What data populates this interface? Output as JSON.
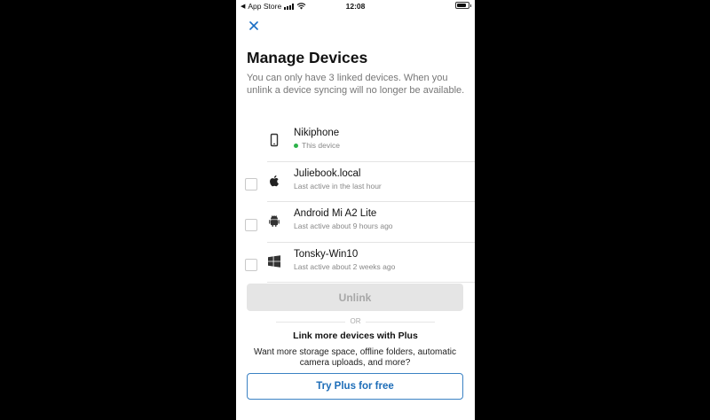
{
  "status_bar": {
    "back_app": "App Store",
    "time": "12:08",
    "battery_level": 0.85
  },
  "header": {
    "close_icon": "close-icon",
    "title": "Manage Devices",
    "description": "You can only have 3 linked devices. When you unlink a device syncing will no longer be available."
  },
  "devices": [
    {
      "name": "Nikiphone",
      "status": "This device",
      "icon": "phone-icon",
      "current": true
    },
    {
      "name": "Juliebook.local",
      "status": "Last active in the last hour",
      "icon": "apple-icon",
      "current": false
    },
    {
      "name": "Android Mi A2 Lite",
      "status": "Last active about 9 hours ago",
      "icon": "android-icon",
      "current": false
    },
    {
      "name": "Tonsky-Win10",
      "status": "Last active about 2 weeks ago",
      "icon": "windows-icon",
      "current": false
    }
  ],
  "actions": {
    "unlink_label": "Unlink",
    "or_label": "OR",
    "plus_title": "Link more devices with Plus",
    "plus_description": "Want more storage space, offline folders, automatic camera uploads, and more?",
    "try_plus_label": "Try Plus for free"
  },
  "colors": {
    "accent": "#1d6db8",
    "online": "#2db34a",
    "disabled_bg": "#e5e5e5"
  }
}
